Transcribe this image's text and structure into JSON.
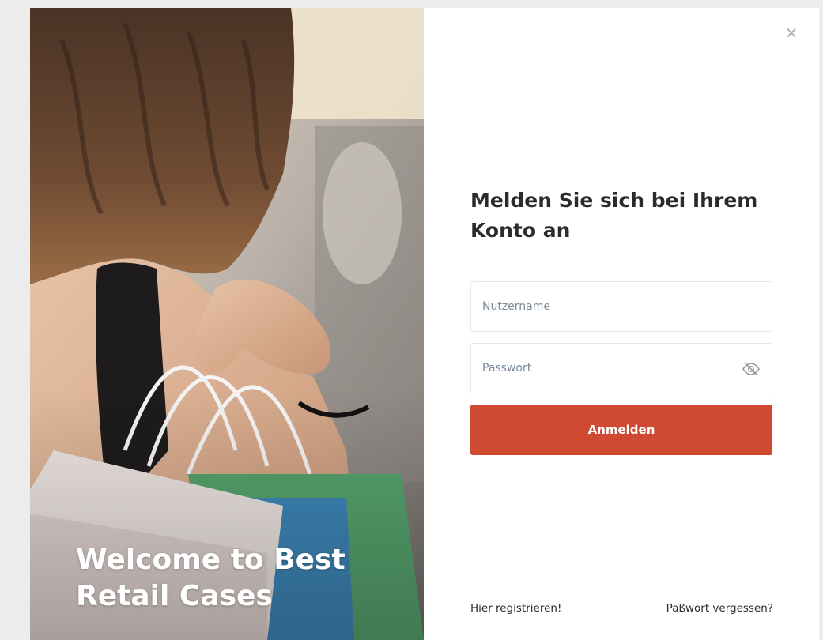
{
  "hero": {
    "title_line1": "Welcome to Best",
    "title_line2": "Retail Cases"
  },
  "login": {
    "heading_line1": "Melden Sie sich bei Ihrem",
    "heading_line2": "Konto an",
    "username_placeholder": "Nutzername",
    "username_value": "",
    "password_placeholder": "Passwort",
    "password_value": "",
    "submit_label": "Anmelden",
    "password_toggle_icon": "eye-off-icon",
    "close_icon": "close-icon"
  },
  "links": {
    "register": "Hier registrieren!",
    "forgot_password": "Paßwort vergessen?"
  },
  "colors": {
    "accent": "#cf4a30",
    "page_background": "#ececec",
    "panel_background": "#ffffff"
  }
}
